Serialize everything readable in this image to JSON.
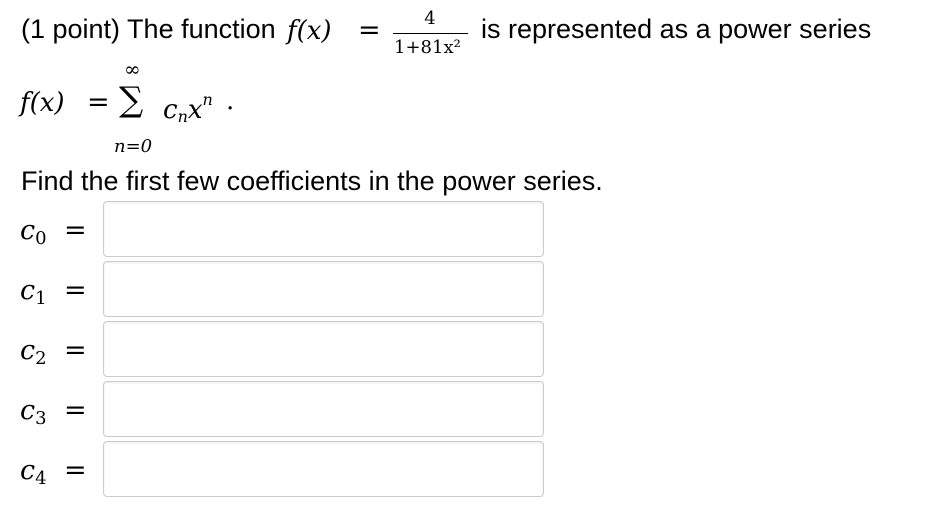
{
  "problem": {
    "intro": "(1 point) The function",
    "fx_label": "f(x)",
    "equals": "=",
    "fraction": {
      "numerator": "4",
      "denominator": "1+81x²"
    },
    "outro": "is represented as a power series",
    "series": {
      "lhs": "f(x)",
      "equals": "=",
      "sigma": "∑",
      "upper": "∞",
      "lower": "n=0",
      "coef": "c",
      "coef_sub": "n",
      "var": "x",
      "exp": "n",
      "period": "."
    },
    "instruction": "Find the first few coefficients in the power series."
  },
  "answers": [
    {
      "label": "c",
      "sub": "0",
      "equals": "=",
      "value": ""
    },
    {
      "label": "c",
      "sub": "1",
      "equals": "=",
      "value": ""
    },
    {
      "label": "c",
      "sub": "2",
      "equals": "=",
      "value": ""
    },
    {
      "label": "c",
      "sub": "3",
      "equals": "=",
      "value": ""
    },
    {
      "label": "c",
      "sub": "4",
      "equals": "=",
      "value": ""
    }
  ]
}
